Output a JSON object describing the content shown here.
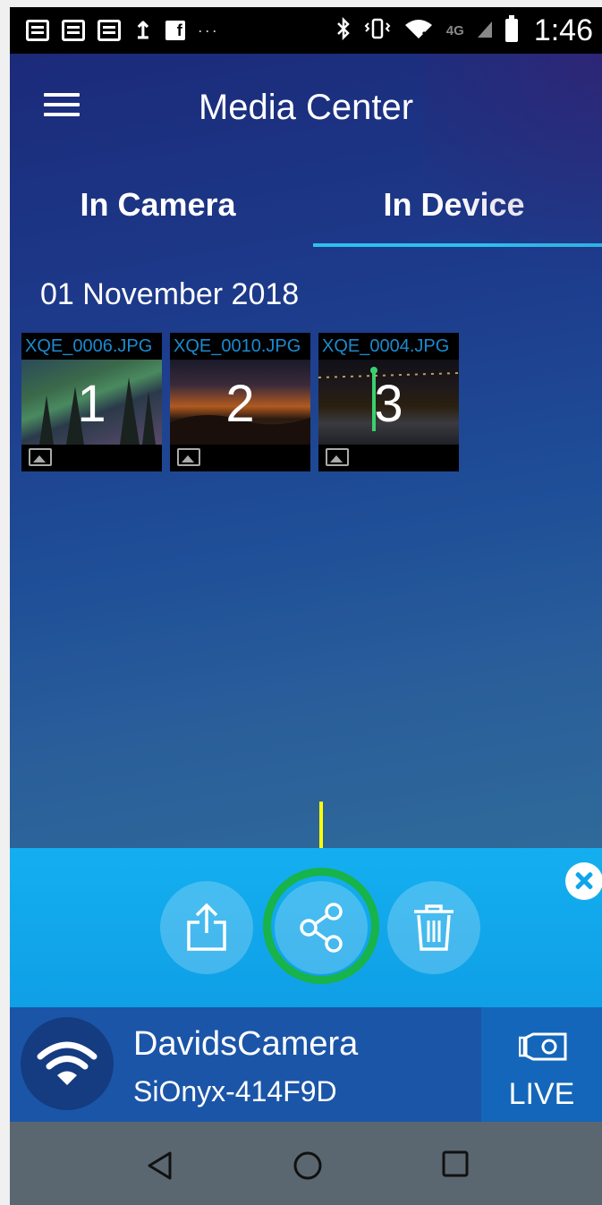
{
  "status_bar": {
    "time": "1:46",
    "network": "4G",
    "icons": [
      "message-icon",
      "message-icon",
      "message-icon",
      "upload-icon",
      "facebook-icon",
      "more-notifications-icon",
      "bluetooth-icon",
      "vibrate-icon",
      "wifi-icon",
      "signal-icon",
      "battery-icon"
    ]
  },
  "app_bar": {
    "title": "Media Center",
    "menu_icon": "hamburger-menu-icon"
  },
  "tabs": [
    {
      "label": "In Camera",
      "active": false
    },
    {
      "label": "In Device",
      "active": true
    }
  ],
  "media": {
    "date": "01 November 2018",
    "items": [
      {
        "filename": "XQE_0006.JPG",
        "number": "1",
        "type_icon": "image-icon"
      },
      {
        "filename": "XQE_0010.JPG",
        "number": "2",
        "type_icon": "image-icon"
      },
      {
        "filename": "XQE_0004.JPG",
        "number": "3",
        "type_icon": "image-icon"
      }
    ]
  },
  "action_bar": {
    "buttons": [
      "export-icon",
      "share-icon",
      "trash-icon"
    ],
    "close_icon": "close-icon",
    "highlight_color": "#18b34a",
    "pointer_color": "#ffff00"
  },
  "connection": {
    "camera_name": "DavidsCamera",
    "camera_id": "SiOnyx-414F9D",
    "live_label": "LIVE"
  },
  "colors": {
    "accent": "#2ec0f0",
    "action_bar": "#10a5ea",
    "connection_bar": "#1b55a8",
    "nav_bar": "#5b6770"
  }
}
